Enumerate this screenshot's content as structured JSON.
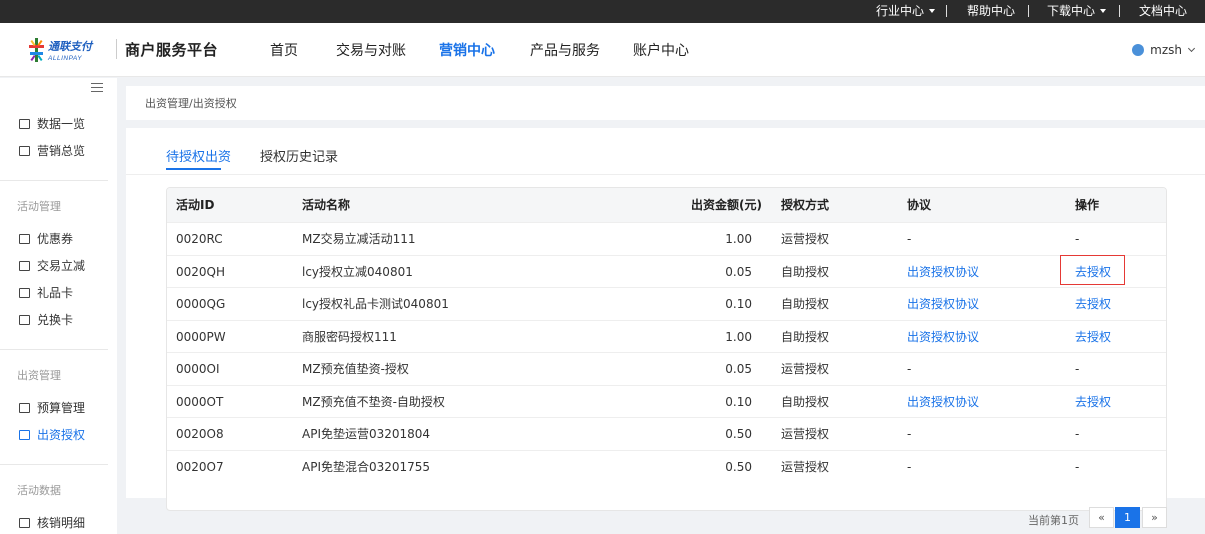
{
  "topbar": {
    "industry": "行业中心",
    "help": "帮助中心",
    "download": "下载中心",
    "docs": "文档中心"
  },
  "header": {
    "logo_cn": "通联支付",
    "logo_en": "ALLINPAY",
    "platform": "商户服务平台",
    "nav": [
      "首页",
      "交易与对账",
      "营销中心",
      "产品与服务",
      "账户中心"
    ],
    "active_nav": "营销中心",
    "username": "mzsh"
  },
  "sidebar": {
    "items_top": [
      "数据一览",
      "营销总览"
    ],
    "group_activity": "活动管理",
    "items_activity": [
      "优惠券",
      "交易立减",
      "礼品卡",
      "兑换卡"
    ],
    "group_funding": "出资管理",
    "items_funding": [
      "预算管理",
      "出资授权"
    ],
    "group_data": "活动数据",
    "items_data": [
      "核销明细"
    ],
    "active_item": "出资授权"
  },
  "breadcrumb": "出资管理/出资授权",
  "tabs": [
    "待授权出资",
    "授权历史记录"
  ],
  "active_tab": "待授权出资",
  "table": {
    "columns": [
      "活动ID",
      "活动名称",
      "出资金额(元)",
      "授权方式",
      "协议",
      "操作"
    ],
    "rows": [
      {
        "id": "0020RC",
        "name": "MZ交易立减活动111",
        "amount": "1.00",
        "method": "运营授权",
        "agreement": "-",
        "action": "-"
      },
      {
        "id": "0020QH",
        "name": "lcy授权立减040801",
        "amount": "0.05",
        "method": "自助授权",
        "agreement": "出资授权协议",
        "action": "去授权"
      },
      {
        "id": "0000QG",
        "name": "lcy授权礼品卡测试040801",
        "amount": "0.10",
        "method": "自助授权",
        "agreement": "出资授权协议",
        "action": "去授权"
      },
      {
        "id": "0000PW",
        "name": "商服密码授权111",
        "amount": "1.00",
        "method": "自助授权",
        "agreement": "出资授权协议",
        "action": "去授权"
      },
      {
        "id": "0000OI",
        "name": "MZ预充值垫资-授权",
        "amount": "0.05",
        "method": "运营授权",
        "agreement": "-",
        "action": "-"
      },
      {
        "id": "0000OT",
        "name": "MZ预充值不垫资-自助授权",
        "amount": "0.10",
        "method": "自助授权",
        "agreement": "出资授权协议",
        "action": "去授权"
      },
      {
        "id": "0020O8",
        "name": "API免垫运营03201804",
        "amount": "0.50",
        "method": "运营授权",
        "agreement": "-",
        "action": "-"
      },
      {
        "id": "0020O7",
        "name": "API免垫混合03201755",
        "amount": "0.50",
        "method": "运营授权",
        "agreement": "-",
        "action": "-"
      }
    ]
  },
  "pagination": {
    "status": "当前第1页",
    "prev": "«",
    "current": "1",
    "next": "»"
  },
  "colors": {
    "accent": "#1a73e8",
    "topbar": "#2b2b2b",
    "highlight": "#e53935"
  }
}
